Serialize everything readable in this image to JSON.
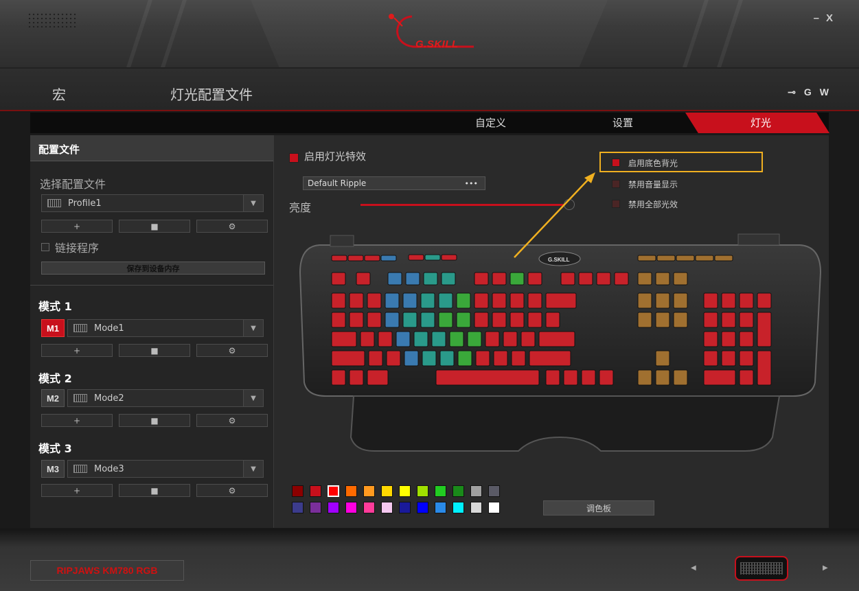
{
  "app": {
    "brand": "G.SKILL",
    "window_controls": {
      "minimize": "–",
      "close": "X"
    }
  },
  "nav": {
    "macro": "宏",
    "lighting_profile": "灯光配置文件",
    "right_icons": {
      "link": "⊸",
      "g": "G",
      "w": "W"
    }
  },
  "tabs": {
    "custom": "自定义",
    "settings": "设置",
    "lighting": "灯光"
  },
  "left": {
    "header": "配置文件",
    "select_profile": "选择配置文件",
    "profile_value": "Profile1",
    "link_program": "链接程序",
    "save_to_device": "保存到设备内存",
    "btn_add": "+",
    "btn_delete": "■",
    "btn_settings": "⚙",
    "modes": [
      {
        "label": "模式 1",
        "badge": "M1",
        "value": "Mode1",
        "active": true
      },
      {
        "label": "模式 2",
        "badge": "M2",
        "value": "Mode2",
        "active": false
      },
      {
        "label": "模式 3",
        "badge": "M3",
        "value": "Mode3",
        "active": false
      }
    ]
  },
  "main": {
    "enable_effect": "启用灯光特效",
    "effect_value": "Default Ripple",
    "effect_more": "•••",
    "brightness": "亮度",
    "brightness_level": 1.0,
    "options": [
      {
        "label": "启用底色背光",
        "checked": true
      },
      {
        "label": "禁用音量显示",
        "checked": false
      },
      {
        "label": "禁用全部光效",
        "checked": false
      }
    ],
    "palette_button": "调色板"
  },
  "palette": {
    "row1": [
      "#8b0000",
      "#c8101c",
      "#ff0000",
      "#ff6a00",
      "#ff9a20",
      "#ffd800",
      "#ffff00",
      "#a0e000",
      "#22cc22",
      "#1a8a1a",
      "#a0a0a0",
      "#5a5a66"
    ],
    "row2": [
      "#3c3c8c",
      "#7a2f9a",
      "#a100ff",
      "#ff00e0",
      "#ff3c9a",
      "#f5c8f0",
      "#1a1a9a",
      "#0000ff",
      "#2a8ae8",
      "#00f0ff",
      "#d8d8d8",
      "#ffffff"
    ],
    "selected_index": 2
  },
  "bottom": {
    "model": "RIPJAWS KM780 RGB",
    "prev": "◀",
    "next": "▶"
  },
  "colors": {
    "accent": "#c8101c",
    "highlight": "#f0b020"
  }
}
